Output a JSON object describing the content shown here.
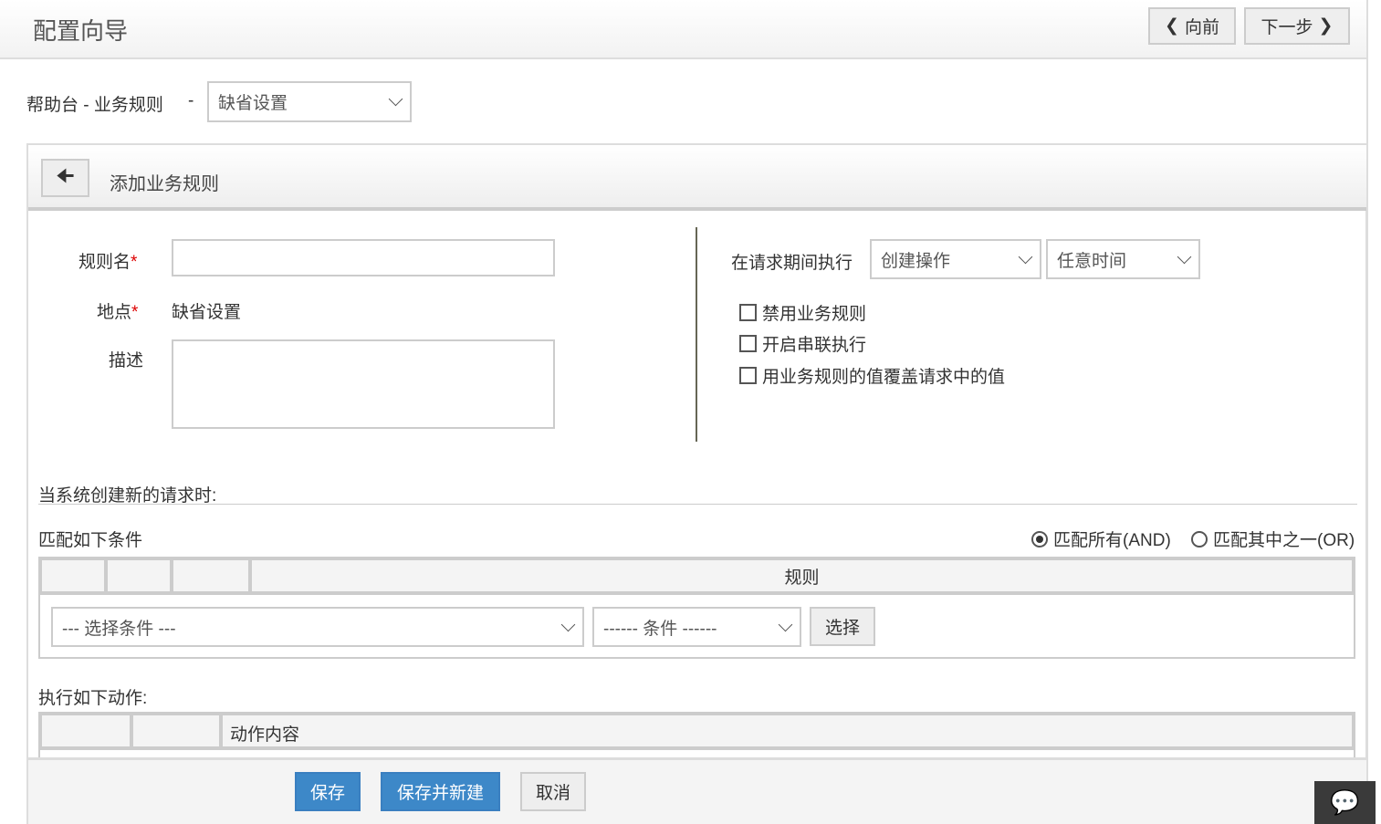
{
  "header": {
    "title": "配置向导",
    "prev": "向前",
    "next": "下一步"
  },
  "breadcrumb": {
    "text": "帮助台 - 业务规则",
    "sep": "-",
    "site_select": "缺省设置"
  },
  "panel": {
    "title": "添加业务规则"
  },
  "form": {
    "rule_name_label": "规则名",
    "location_label": "地点",
    "location_value": "缺省设置",
    "desc_label": "描述",
    "required": "*",
    "exec_label": "在请求期间执行",
    "exec_op": "创建操作",
    "exec_time": "任意时间",
    "checkboxes": [
      "禁用业务规则",
      "开启串联执行",
      "用业务规则的值覆盖请求中的值"
    ]
  },
  "conditions": {
    "section": "当系统创建新的请求时:",
    "match_label": "匹配如下条件",
    "match_all": "匹配所有(AND)",
    "match_any": "匹配其中之一(OR)",
    "rule_header": "规则",
    "select_condition": "--- 选择条件 ---",
    "condition": "------ 条件 ------",
    "choose": "选择"
  },
  "actions": {
    "section": "执行如下动作:",
    "content_header": "动作内容"
  },
  "footer": {
    "save": "保存",
    "save_new": "保存并新建",
    "cancel": "取消"
  }
}
